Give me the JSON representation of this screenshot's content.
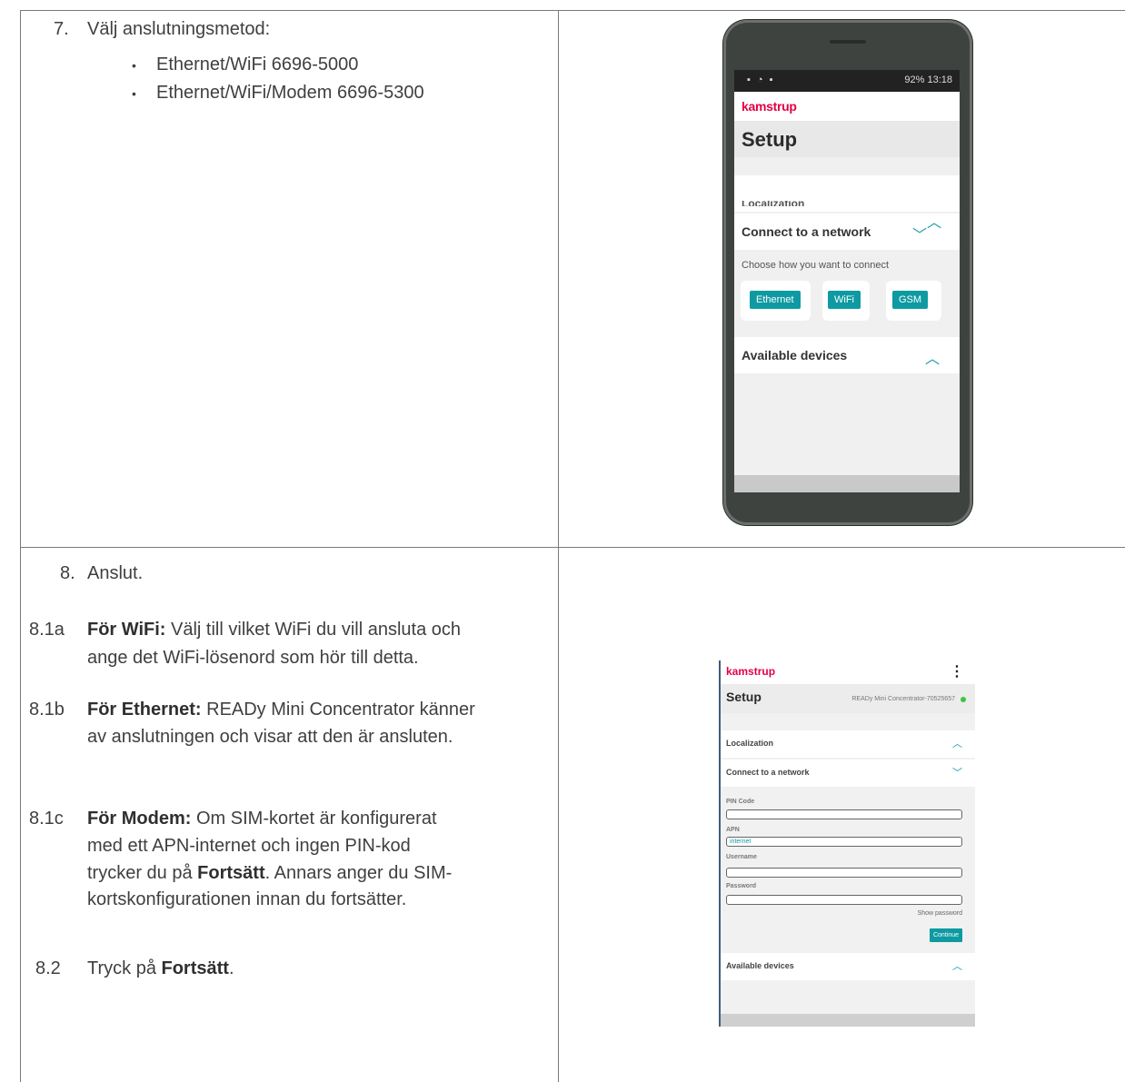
{
  "step7": {
    "number": "7.",
    "text": "Välj anslutningsmetod:",
    "bullets": [
      "Ethernet/WiFi 6696-5000",
      "Ethernet/WiFi/Modem 6696-5300"
    ]
  },
  "step8": {
    "number": "8.",
    "text": "Anslut.",
    "sub_1a": {
      "num": "8.1a",
      "bold": "För WiFi:",
      "line1": " Välj till vilket WiFi du vill ansluta och",
      "line2": "ange det WiFi-lösenord som hör till detta."
    },
    "sub_1b": {
      "num": "8.1b",
      "bold": "För Ethernet:",
      "line1": " READy Mini Concentrator känner",
      "line2": "av anslutningen och visar att den är ansluten."
    },
    "sub_1c": {
      "num": "8.1c",
      "bold": "För Modem:",
      "line1": " Om SIM-kortet är konfigurerat",
      "line2": "med ett APN-internet och ingen PIN-kod",
      "line3_pre": "trycker du på ",
      "line3_bold": "Fortsätt",
      "line3_post": ". Annars anger du SIM-",
      "line4": "kortskonfigurationen innan du fortsätter."
    },
    "sub_2": {
      "num": "8.2",
      "pre": "Tryck på ",
      "bold": "Fortsätt",
      "post": "."
    }
  },
  "phone1": {
    "status_right": "92% 13:18",
    "brand": "kamstrup",
    "title": "Setup",
    "partial_row": "Localization",
    "connect_label": "Connect to a network",
    "choose_text": "Choose how you want to connect",
    "buttons": [
      "Ethernet",
      "WiFi",
      "GSM"
    ],
    "available_label": "Available devices"
  },
  "phone2": {
    "brand": "kamstrup",
    "menu_glyph": "⋮",
    "title": "Setup",
    "device": "READy Mini Concentrator-70525657",
    "localization": "Localization",
    "connect": "Connect to a network",
    "pin_label": "PIN Code",
    "apn_label": "APN",
    "apn_value": "internet",
    "username_label": "Username",
    "password_label": "Password",
    "show_password": "Show password",
    "continue": "Continue",
    "available": "Available devices"
  },
  "colors": {
    "accent": "#0e9aa2",
    "brand": "#e30045",
    "online": "#3ec43e"
  }
}
